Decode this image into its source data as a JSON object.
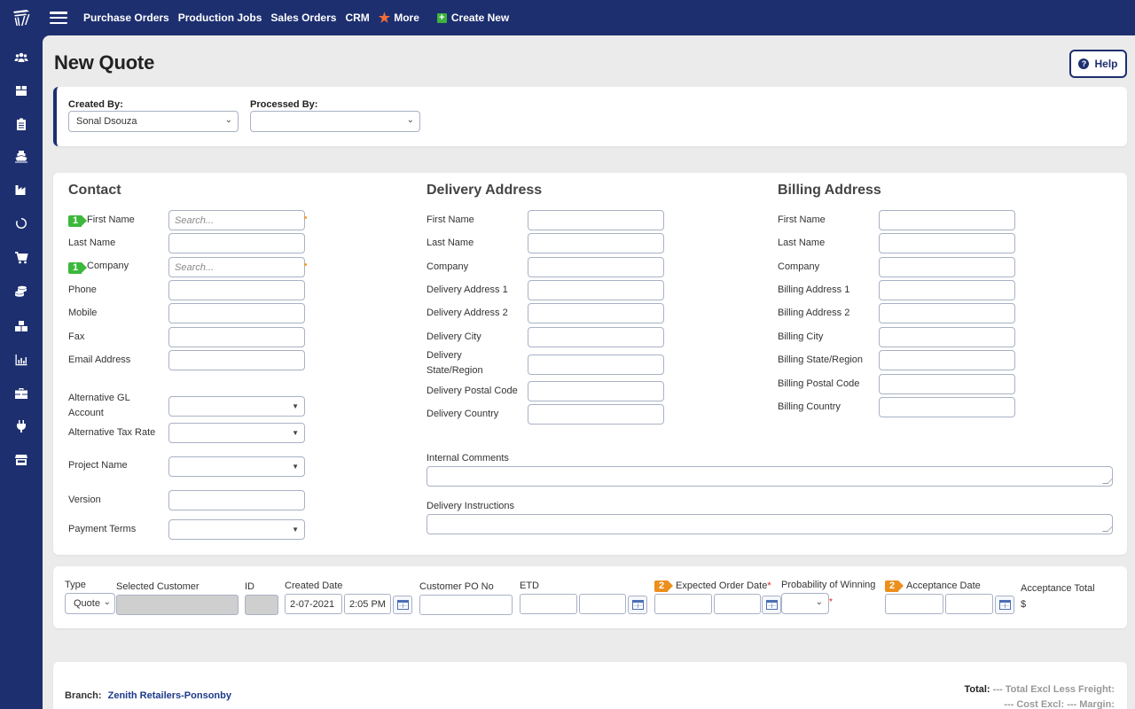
{
  "topnav": {
    "links": [
      "Purchase Orders",
      "Production Jobs",
      "Sales Orders",
      "CRM"
    ],
    "more_label": "More",
    "create_new_label": "Create New"
  },
  "sidebar": {
    "icons": [
      "users-icon",
      "box-icon",
      "clipboard-icon",
      "ship-icon",
      "factory-icon",
      "circle-loading-icon",
      "cart-icon",
      "coins-icon",
      "boxes-icon",
      "chart-bar-icon",
      "briefcase-icon",
      "plug-icon",
      "store-icon"
    ]
  },
  "page": {
    "title": "New Quote",
    "help_label": "Help"
  },
  "assignment": {
    "created_by_label": "Created By:",
    "created_by_value": "Sonal Dsouza",
    "processed_by_label": "Processed By:",
    "processed_by_value": ""
  },
  "contact": {
    "title": "Contact",
    "badge": "1",
    "fields": [
      {
        "label": "First Name",
        "placeholder": "Search..."
      },
      {
        "label": "Last Name",
        "placeholder": ""
      },
      {
        "label": "Company",
        "placeholder": "Search..."
      },
      {
        "label": "Phone",
        "placeholder": ""
      },
      {
        "label": "Mobile",
        "placeholder": ""
      },
      {
        "label": "Fax",
        "placeholder": ""
      },
      {
        "label": "Email Address",
        "placeholder": ""
      }
    ],
    "extra_fields": [
      {
        "label": "Alternative GL Account",
        "value": ""
      },
      {
        "label": "Alternative Tax Rate",
        "value": ""
      },
      {
        "label": "Project Name",
        "value": ""
      },
      {
        "label": "Version",
        "value": ""
      },
      {
        "label": "Payment Terms",
        "value": ""
      }
    ]
  },
  "delivery": {
    "title": "Delivery Address",
    "fields": [
      "First Name",
      "Last Name",
      "Company",
      "Delivery Address 1",
      "Delivery Address 2",
      "Delivery City",
      "Delivery State/Region",
      "Delivery Postal Code",
      "Delivery Country"
    ]
  },
  "billing": {
    "title": "Billing Address",
    "fields": [
      "First Name",
      "Last Name",
      "Company",
      "Billing Address 1",
      "Billing Address 2",
      "Billing City",
      "Billing State/Region",
      "Billing Postal Code",
      "Billing Country"
    ]
  },
  "comments": {
    "internal_label": "Internal Comments",
    "internal_value": "",
    "delivery_label": "Delivery Instructions",
    "delivery_value": ""
  },
  "quote_details": {
    "type_label": "Type",
    "type_value": "Quote",
    "selected_customer_label": "Selected Customer",
    "id_label": "ID",
    "created_date_label": "Created Date",
    "created_date_value": "2-07-2021",
    "created_time_value": "2:05 PM",
    "customer_po_label": "Customer PO No",
    "etd_label": "ETD",
    "expected_order_date_label": "Expected Order Date",
    "expected_badge": "2",
    "probability_label": "Probability of Winning",
    "acceptance_date_label": "Acceptance Date",
    "acceptance_badge": "2",
    "acceptance_total_label": "Acceptance Total",
    "acceptance_total_value": "$",
    "required_mark": "*"
  },
  "summary": {
    "branch_label": "Branch:",
    "branch_value": "Zenith Retailers-Ponsonby",
    "total_label": "Total:",
    "total_value": "---",
    "total_excl_less_freight_label": "Total Excl Less Freight:",
    "total_excl_less_freight_value": "---",
    "cost_excl_label": "Cost Excl:",
    "cost_excl_value": "---",
    "margin_label": "Margin:"
  },
  "colors": {
    "brand_navy": "#1d2f6f",
    "badge_green": "#3cb83c",
    "badge_orange": "#ec8f1c",
    "required_red": "#d92020",
    "star_orange": "#f26b3a"
  }
}
